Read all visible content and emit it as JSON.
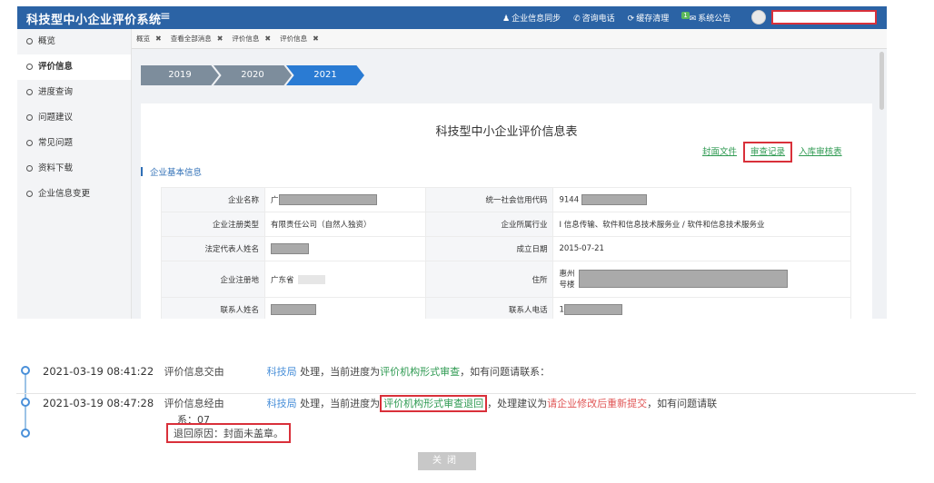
{
  "app": {
    "title": "科技型中小企业评价系统",
    "top_links": [
      {
        "icon": "user-icon",
        "glyph": "♟",
        "label": "企业信息同步"
      },
      {
        "icon": "phone-icon",
        "glyph": "✆",
        "label": "咨询电话"
      },
      {
        "icon": "refresh-icon",
        "glyph": "⟳",
        "label": "缓存清理"
      },
      {
        "icon": "mail-icon",
        "glyph": "✉",
        "label": "系统公告",
        "badge": "1"
      }
    ]
  },
  "sidebar": {
    "items": [
      {
        "label": "概览"
      },
      {
        "label": "评价信息"
      },
      {
        "label": "进度查询"
      },
      {
        "label": "问题建议"
      },
      {
        "label": "常见问题"
      },
      {
        "label": "资料下载"
      },
      {
        "label": "企业信息变更"
      }
    ]
  },
  "tabs": [
    {
      "label": "概览"
    },
    {
      "label": "查看全部消息"
    },
    {
      "label": "评价信息"
    },
    {
      "label": "评价信息"
    }
  ],
  "years": [
    "2019",
    "2020",
    "2021"
  ],
  "panel": {
    "title": "科技型中小企业评价信息表",
    "links": {
      "cover": "封面文件",
      "review": "审查记录",
      "warehouse": "入库审核表"
    },
    "section": "企业基本信息"
  },
  "info": {
    "name_label": "企业名称",
    "name_value": "广",
    "credit_label": "统一社会信用代码",
    "credit_value": "9144",
    "type_label": "企业注册类型",
    "type_value": "有限责任公司（自然人独资）",
    "industry_label": "企业所属行业",
    "industry_value": "I 信息传输、软件和信息技术服务业 / 软件和信息技术服务业",
    "rep_label": "法定代表人姓名",
    "rep_value": "",
    "date_label": "成立日期",
    "date_value": "2015-07-21",
    "reg_label": "企业注册地",
    "reg_value": "广东省",
    "addr_label": "住所",
    "addr_value_1": "惠州",
    "addr_value_2": "号楼",
    "contact_label": "联系人姓名",
    "contact_value": "",
    "phone_label": "联系人电话",
    "phone_value": "1"
  },
  "timeline": {
    "entries": [
      {
        "time": "2021-03-19 08:41:22",
        "text1": "评价信息交由",
        "org": "科技局",
        "text2": "处理，当前进度为",
        "stage": "评价机构形式审查",
        "text3": "，如有问题请联系："
      },
      {
        "time": "2021-03-19 08:47:28",
        "text1": "评价信息经由",
        "org": "科技局",
        "text2": "处理，当前进度为",
        "stage": "评价机构形式审查退回",
        "text3": "，处理建议为",
        "suggestion": "请企业修改后重新提交",
        "text4": "，如有问题请联",
        "cont": "系：07",
        "reason": "退回原因：封面未盖章。"
      }
    ],
    "close_label": "关闭"
  }
}
